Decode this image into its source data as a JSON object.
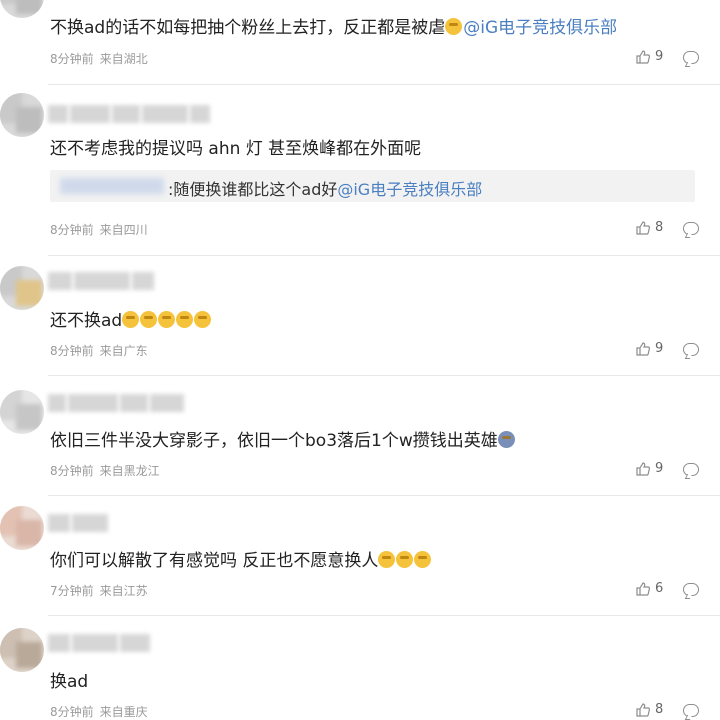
{
  "comments": [
    {
      "text": "不换ad的话不如每把抽个粉丝上去打，反正都是被虐",
      "mention": "@iG电子竞技俱乐部",
      "time": "8分钟前",
      "location": "来自湖北",
      "likes": "9"
    },
    {
      "text": "还不考虑我的提议吗 ahn 灯 甚至焕峰都在外面呢",
      "quote_text": ":随便换谁都比这个ad好",
      "quote_mention": "@iG电子竞技俱乐部",
      "time": "8分钟前",
      "location": "来自四川",
      "likes": "8"
    },
    {
      "text": "还不换ad",
      "time": "8分钟前",
      "location": "来自广东",
      "likes": "9"
    },
    {
      "text": "依旧三件半没大穿影子，依旧一个bo3落后1个w攒钱出英雄",
      "time": "8分钟前",
      "location": "来自黑龙江",
      "likes": "9"
    },
    {
      "text": "你们可以解散了有感觉吗 反正也不愿意换人",
      "time": "7分钟前",
      "location": "来自江苏",
      "likes": "6"
    },
    {
      "text": "换ad",
      "time": "8分钟前",
      "location": "来自重庆",
      "likes": "8"
    }
  ],
  "icons": {
    "like": "thumbs-up-icon",
    "reply": "comment-bubble-icon",
    "emoji": "emoji-face-icon"
  },
  "colors": {
    "mention": "#4a7fc1",
    "meta": "#9a9a9a",
    "quote_bg": "#f2f2f2"
  }
}
